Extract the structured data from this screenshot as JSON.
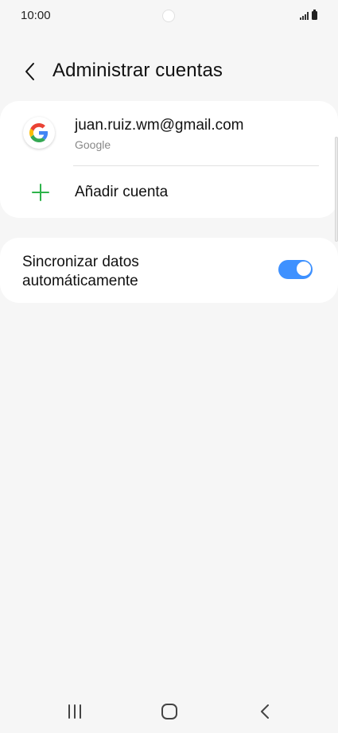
{
  "status_bar": {
    "time": "10:00",
    "icons": [
      "signal-icon",
      "battery-icon"
    ]
  },
  "header": {
    "title": "Administrar cuentas",
    "back_icon": "chevron-left-icon"
  },
  "accounts": [
    {
      "email": "juan.ruiz.wm@gmail.com",
      "provider": "Google",
      "icon": "google-logo-icon"
    }
  ],
  "add_account": {
    "label": "Añadir cuenta",
    "icon": "plus-icon"
  },
  "sync": {
    "label": "Sincronizar datos automáticamente",
    "enabled": true
  },
  "nav_bar": {
    "buttons": [
      "recent-apps-icon",
      "home-icon",
      "back-icon"
    ]
  },
  "colors": {
    "accent": "#3e91ff",
    "plus_green": "#2db34a",
    "background": "#f6f6f6",
    "card": "#ffffff"
  }
}
